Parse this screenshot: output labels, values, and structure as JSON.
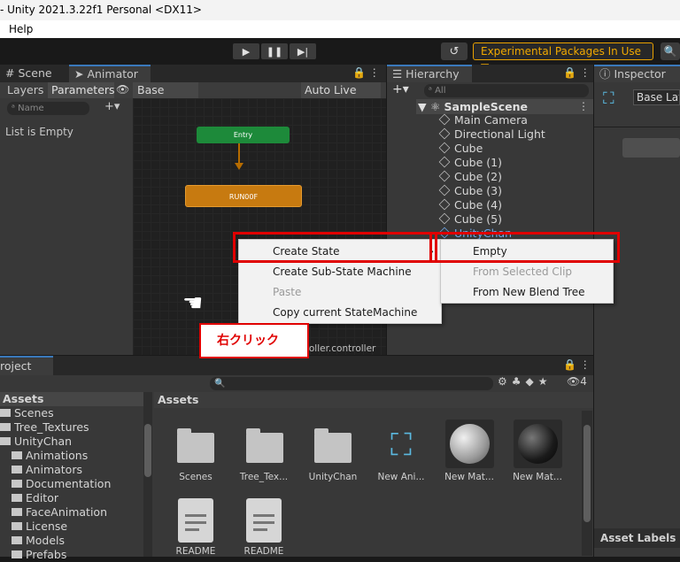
{
  "window": {
    "title": "- Unity 2021.3.22f1 Personal <DX11>",
    "menu": [
      "Help"
    ]
  },
  "toolbar": {
    "experimental": "Experimental Packages In Use ▼",
    "history_icon": "history-icon",
    "search_icon": "search-icon"
  },
  "animator": {
    "tabs": [
      "# Scene",
      "➤ Animator"
    ],
    "subtabs": [
      "Layers",
      "Parameters"
    ],
    "eye": "👁",
    "base_layer": "Base Layer",
    "auto_live_link": "Auto Live Link",
    "search_placeholder": "ᵃ Name",
    "plus": "+▾",
    "list_empty": "List is Empty",
    "entry_node": "Entry",
    "state_node": "RUN00F",
    "footer": "ntroller.controller",
    "lock": "🔒⋮"
  },
  "hierarchy": {
    "tab": "☰ Hierarchy",
    "search_placeholder": "ᵃ All",
    "scene": "SampleScene",
    "items": [
      "Main Camera",
      "Directional Light",
      "Cube",
      "Cube (1)",
      "Cube (2)",
      "Cube (3)",
      "Cube (4)",
      "Cube (5)",
      "UnityChan"
    ]
  },
  "inspector": {
    "tab": "ⓘ Inspector",
    "title": "Base Lay",
    "asset_labels": "Asset Labels"
  },
  "context_menu": {
    "items": [
      "Create State",
      "Create Sub-State Machine",
      "Paste",
      "Copy current StateMachine"
    ],
    "submenu": [
      "Empty",
      "From Selected Clip",
      "From New Blend Tree"
    ]
  },
  "annotation": {
    "right_click": "右クリック"
  },
  "project": {
    "tab": "roject",
    "count": "4",
    "assets_header": "Assets",
    "tree": [
      "Assets",
      "Scenes",
      "Tree_Textures",
      "UnityChan",
      "Animations",
      "Animators",
      "Documentation",
      "Editor",
      "FaceAnimation",
      "License",
      "Models",
      "Prefabs"
    ],
    "grid": [
      "Scenes",
      "Tree_Tex...",
      "UnityChan",
      "New Ani...",
      "New Mat...",
      "New Mat...",
      "README",
      "README"
    ]
  }
}
